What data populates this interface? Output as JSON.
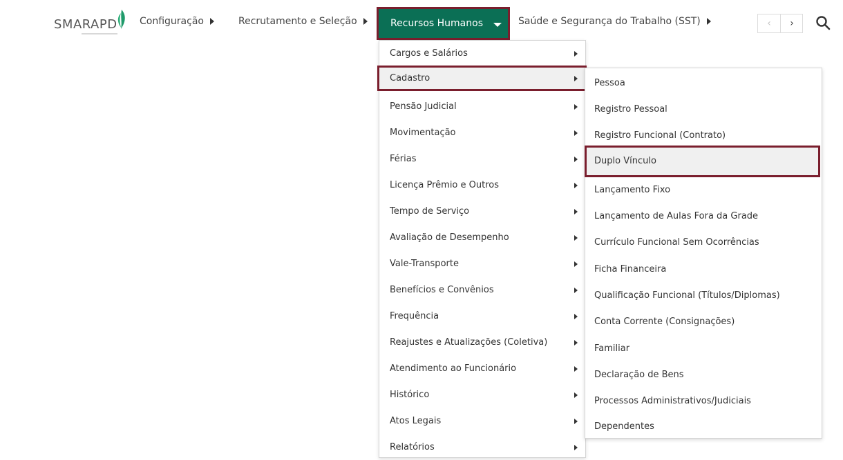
{
  "logo": {
    "text": "SMARAPD",
    "leaf_color": "#1f9a6a"
  },
  "nav": {
    "items": [
      {
        "label": "Configuração"
      },
      {
        "label": "Recrutamento e Seleção"
      },
      {
        "label": "Recursos Humanos",
        "active": true
      },
      {
        "label": "Saúde e Segurança do Trabalho (SST)"
      }
    ],
    "pager_prev": "‹",
    "pager_next": "›"
  },
  "colors": {
    "active_bg": "#0b6f55",
    "highlight_border": "#7a1e2d",
    "hover_bg": "#f0f0f0"
  },
  "menu_rh": {
    "items": [
      {
        "label": "Cargos e Salários"
      },
      {
        "label": "Cadastro",
        "highlighted": true
      },
      {
        "label": "Pensão Judicial"
      },
      {
        "label": "Movimentação"
      },
      {
        "label": "Férias"
      },
      {
        "label": "Licença Prêmio e Outros"
      },
      {
        "label": "Tempo de Serviço"
      },
      {
        "label": "Avaliação de Desempenho"
      },
      {
        "label": "Vale-Transporte"
      },
      {
        "label": "Benefícios e Convênios"
      },
      {
        "label": "Frequência"
      },
      {
        "label": "Reajustes e Atualizações (Coletiva)"
      },
      {
        "label": "Atendimento ao Funcionário"
      },
      {
        "label": "Histórico"
      },
      {
        "label": "Atos Legais"
      },
      {
        "label": "Relatórios"
      }
    ]
  },
  "menu_cadastro": {
    "items": [
      {
        "label": "Pessoa"
      },
      {
        "label": "Registro Pessoal"
      },
      {
        "label": "Registro Funcional (Contrato)"
      },
      {
        "label": "Duplo Vínculo",
        "highlighted": true
      },
      {
        "label": "Lançamento Fixo"
      },
      {
        "label": "Lançamento de Aulas Fora da Grade"
      },
      {
        "label": "Currículo Funcional Sem Ocorrências"
      },
      {
        "label": "Ficha Financeira"
      },
      {
        "label": "Qualificação Funcional (Títulos/Diplomas)"
      },
      {
        "label": "Conta Corrente (Consignações)"
      },
      {
        "label": "Familiar"
      },
      {
        "label": "Declaração de Bens"
      },
      {
        "label": "Processos Administrativos/Judiciais"
      },
      {
        "label": "Dependentes"
      }
    ]
  }
}
